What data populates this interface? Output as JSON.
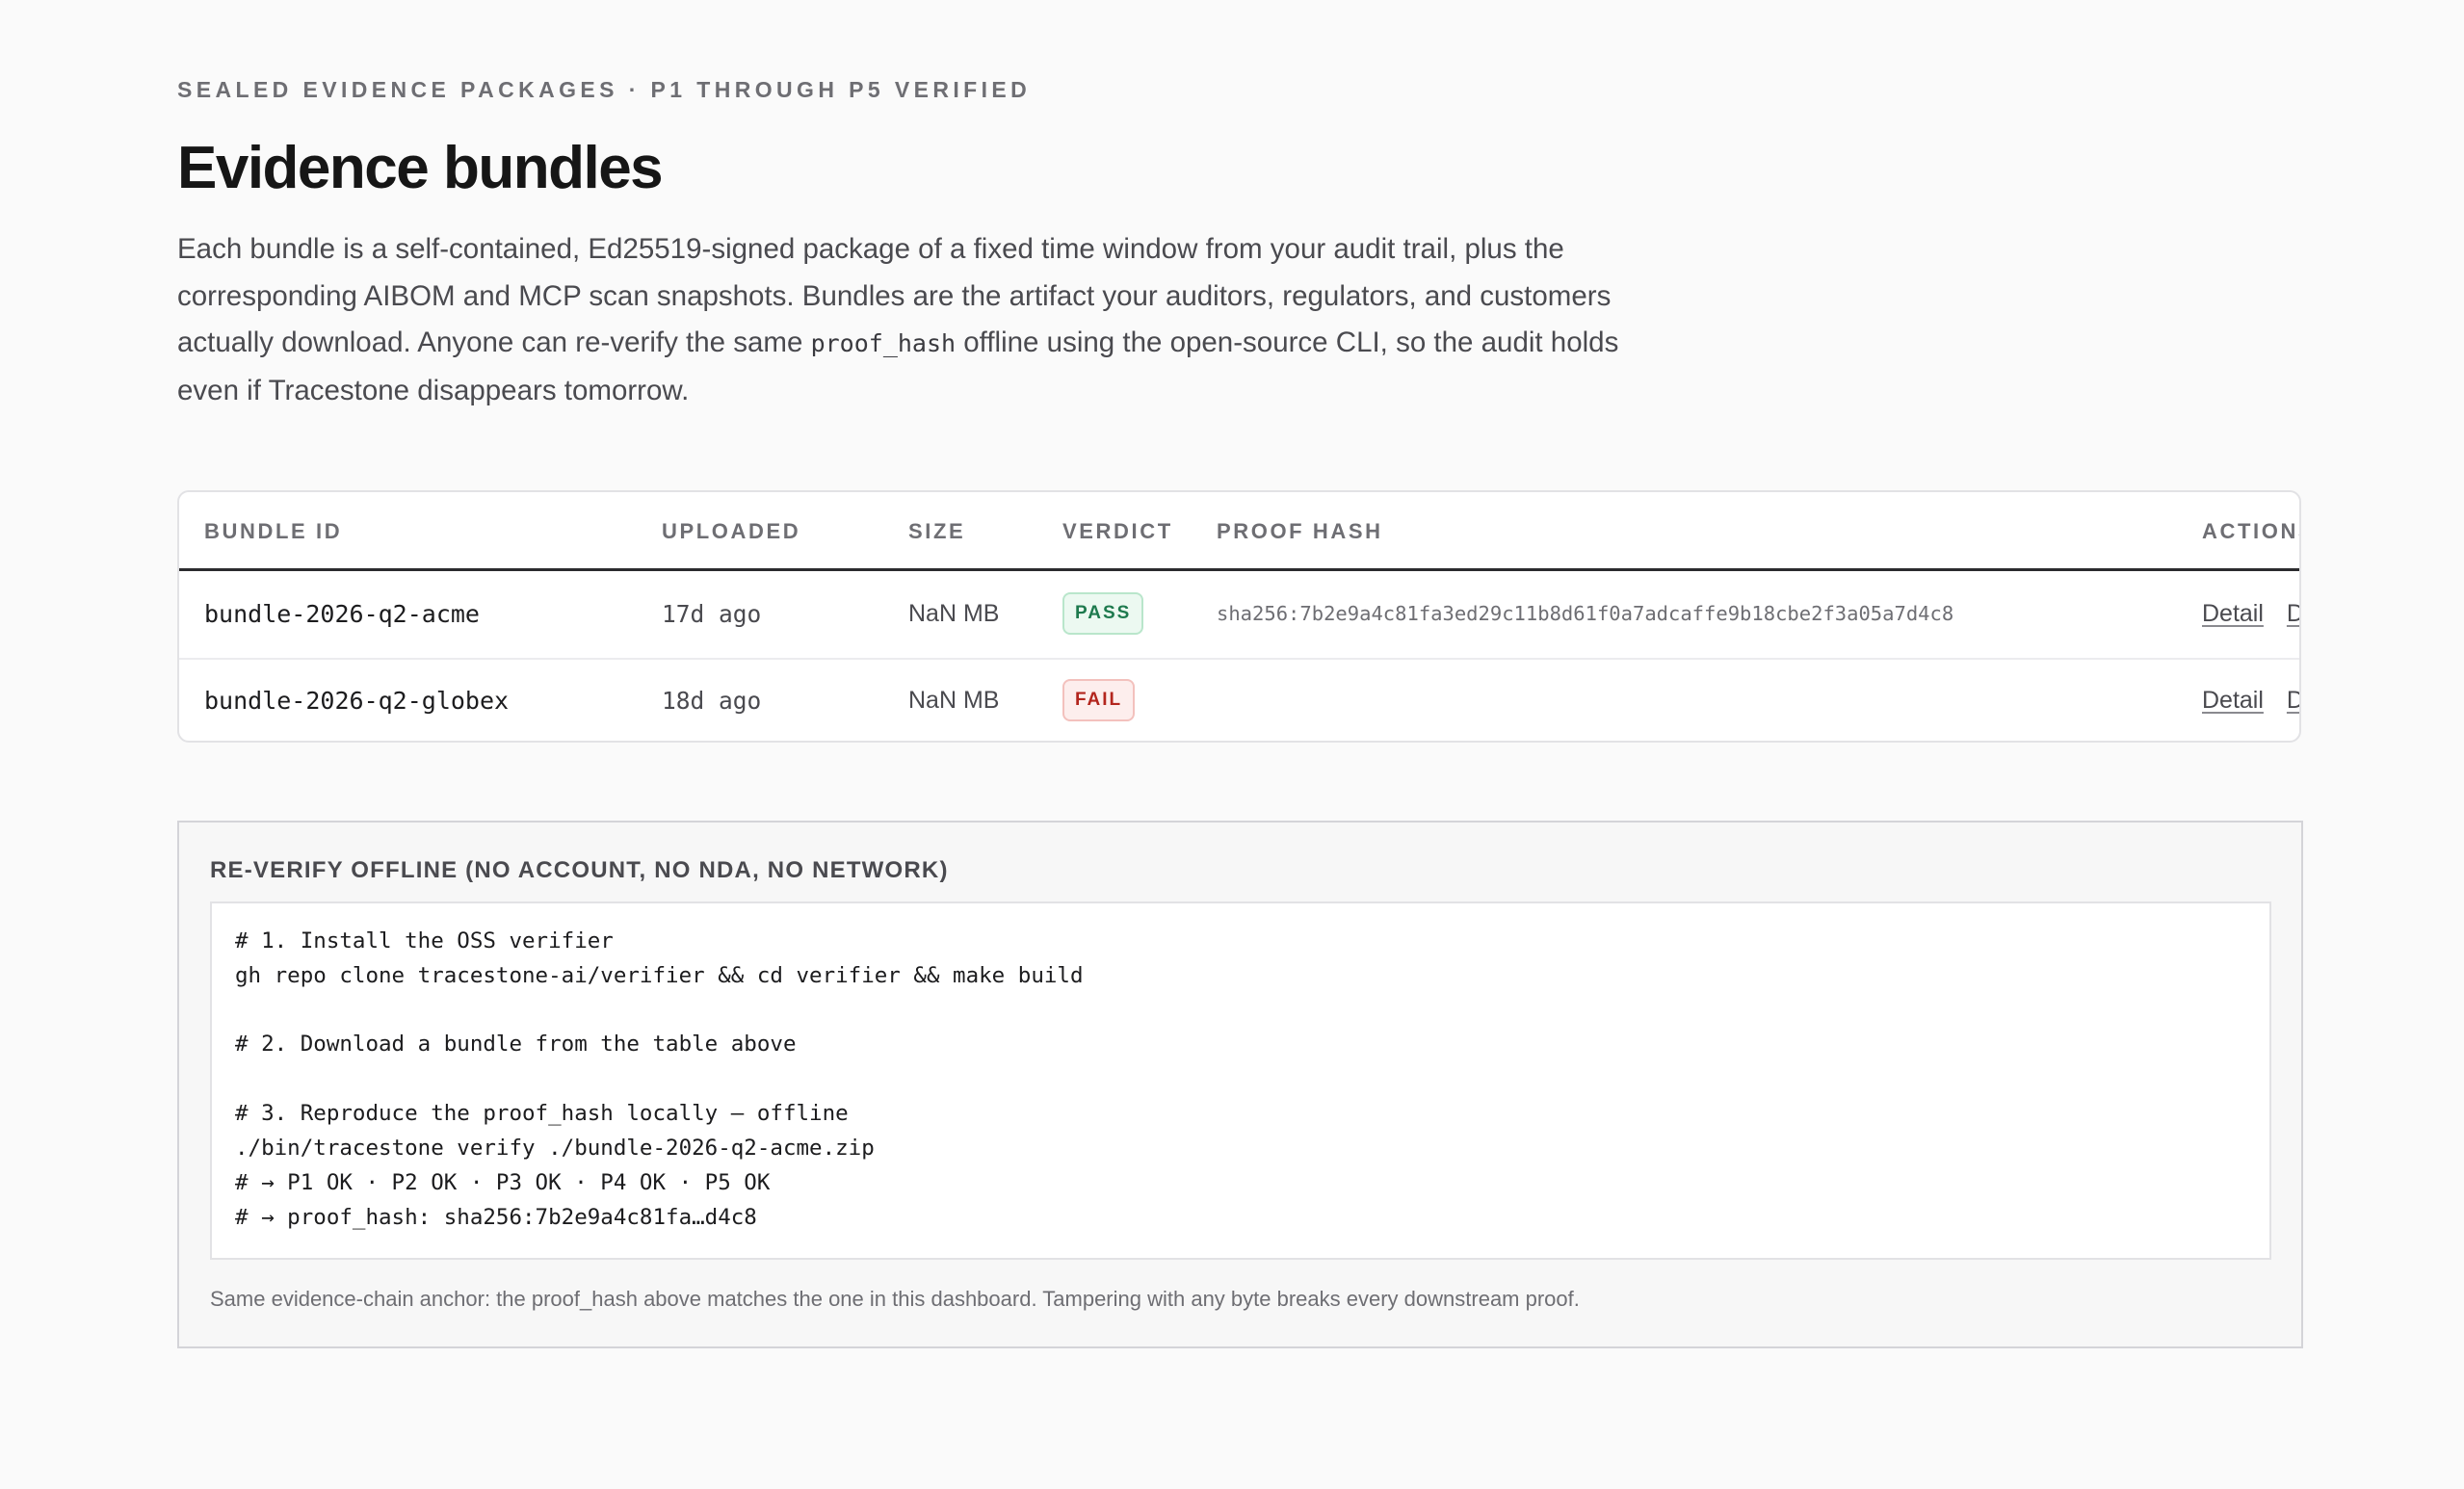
{
  "header": {
    "eyebrow": "SEALED EVIDENCE PACKAGES · P1 THROUGH P5 VERIFIED",
    "title": "Evidence bundles",
    "intro_before": "Each bundle is a self-contained, Ed25519-signed package of a fixed time window from your audit trail, plus the corresponding AIBOM and MCP scan snapshots. Bundles are the artifact your auditors, regulators, and customers actually download. Anyone can re-verify the same ",
    "intro_code": "proof_hash",
    "intro_after": " offline using the open-source CLI, so the audit holds even if Tracestone disappears tomorrow."
  },
  "table": {
    "columns": {
      "bundle_id": "BUNDLE ID",
      "uploaded": "UPLOADED",
      "size": "SIZE",
      "verdict": "VERDICT",
      "proof_hash": "PROOF HASH",
      "actions": "ACTIONS"
    },
    "rows": [
      {
        "bundle_id": "bundle-2026-q2-acme",
        "uploaded": "17d ago",
        "size": "NaN MB",
        "verdict": "PASS",
        "proof_hash": "sha256:7b2e9a4c81fa3ed29c11b8d61f0a7adcaffe9b18cbe2f3a05a7d4c8",
        "detail_label": "Detail",
        "download_label": "Download"
      },
      {
        "bundle_id": "bundle-2026-q2-globex",
        "uploaded": "18d ago",
        "size": "NaN MB",
        "verdict": "FAIL",
        "proof_hash": "",
        "detail_label": "Detail",
        "download_label": "Download"
      }
    ]
  },
  "verify": {
    "title": "RE-VERIFY OFFLINE (NO ACCOUNT, NO NDA, NO NETWORK)",
    "code_lines": [
      "# 1. Install the OSS verifier",
      "gh repo clone tracestone-ai/verifier && cd verifier && make build",
      "",
      "# 2. Download a bundle from the table above",
      "",
      "# 3. Reproduce the proof_hash locally — offline",
      "./bin/tracestone verify ./bundle-2026-q2-acme.zip",
      "# → P1 OK · P2 OK · P3 OK · P4 OK · P5 OK",
      "# → proof_hash: sha256:7b2e9a4c81fa…d4c8"
    ],
    "footnote": "Same evidence-chain anchor: the proof_hash above matches the one in this dashboard. Tampering with any byte breaks every downstream proof."
  },
  "colors": {
    "pass": "#1e7a4e",
    "fail": "#b3261e",
    "background": "#fafafa"
  }
}
